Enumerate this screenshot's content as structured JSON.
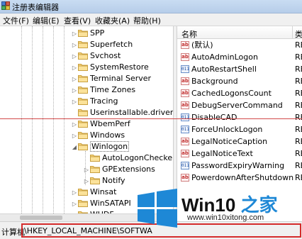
{
  "window": {
    "title": "注册表编辑器"
  },
  "menu": [
    {
      "label": "文件(F)"
    },
    {
      "label": "编辑(E)"
    },
    {
      "label": "查看(V)"
    },
    {
      "label": "收藏夹(A)"
    },
    {
      "label": "帮助(H)"
    }
  ],
  "tree": {
    "items": [
      {
        "label": "SPP",
        "expandable": true
      },
      {
        "label": "Superfetch",
        "expandable": true
      },
      {
        "label": "Svchost",
        "expandable": true
      },
      {
        "label": "SystemRestore",
        "expandable": true
      },
      {
        "label": "Terminal Server",
        "expandable": true
      },
      {
        "label": "Time Zones",
        "expandable": true
      },
      {
        "label": "Tracing",
        "expandable": true
      },
      {
        "label": "Userinstallable.drivers",
        "expandable": false
      },
      {
        "label": "WbemPerf",
        "expandable": true
      },
      {
        "label": "Windows",
        "expandable": true
      },
      {
        "label": "Winlogon",
        "expandable": true,
        "expanded": true,
        "selected": true
      },
      {
        "label": "AutoLogonChecke",
        "expandable": false,
        "child": true
      },
      {
        "label": "GPExtensions",
        "expandable": true,
        "child": true
      },
      {
        "label": "Notify",
        "expandable": true,
        "child": true
      },
      {
        "label": "Winsat",
        "expandable": true
      },
      {
        "label": "WinSATAPI",
        "expandable": true
      },
      {
        "label": "WUDF",
        "expandable": true
      }
    ]
  },
  "values": {
    "col_name": "名称",
    "col_type": "类",
    "rows": [
      {
        "name": "(默认)",
        "type": "RE",
        "icon": "string-value-icon"
      },
      {
        "name": "AutoAdminLogon",
        "type": "RE",
        "icon": "string-value-icon"
      },
      {
        "name": "AutoRestartShell",
        "type": "RE",
        "icon": "binary-value-icon"
      },
      {
        "name": "Background",
        "type": "RE",
        "icon": "string-value-icon"
      },
      {
        "name": "CachedLogonsCount",
        "type": "RE",
        "icon": "string-value-icon"
      },
      {
        "name": "DebugServerCommand",
        "type": "RE",
        "icon": "string-value-icon"
      },
      {
        "name": "DisableCAD",
        "type": "RE",
        "icon": "binary-value-icon"
      },
      {
        "name": "ForceUnlockLogon",
        "type": "RE",
        "icon": "binary-value-icon"
      },
      {
        "name": "LegalNoticeCaption",
        "type": "RE",
        "icon": "string-value-icon"
      },
      {
        "name": "LegalNoticeText",
        "type": "RE",
        "icon": "string-value-icon"
      },
      {
        "name": "PasswordExpiryWarning",
        "type": "RE",
        "icon": "binary-value-icon"
      },
      {
        "name": "PowerdownAfterShutdown",
        "type": "RE",
        "icon": "string-value-icon"
      }
    ]
  },
  "status": {
    "label": "计算机",
    "path": "\\HKEY_LOCAL_MACHINE\\SOFTWA"
  },
  "watermark": {
    "title_main": "Win10",
    "title_accent": " 之家",
    "url": "www.win10xitong.com"
  },
  "colors": {
    "selection_border": "#666666",
    "highlight_red": "#d42b2b",
    "logo_blue": "#1e88d6"
  }
}
